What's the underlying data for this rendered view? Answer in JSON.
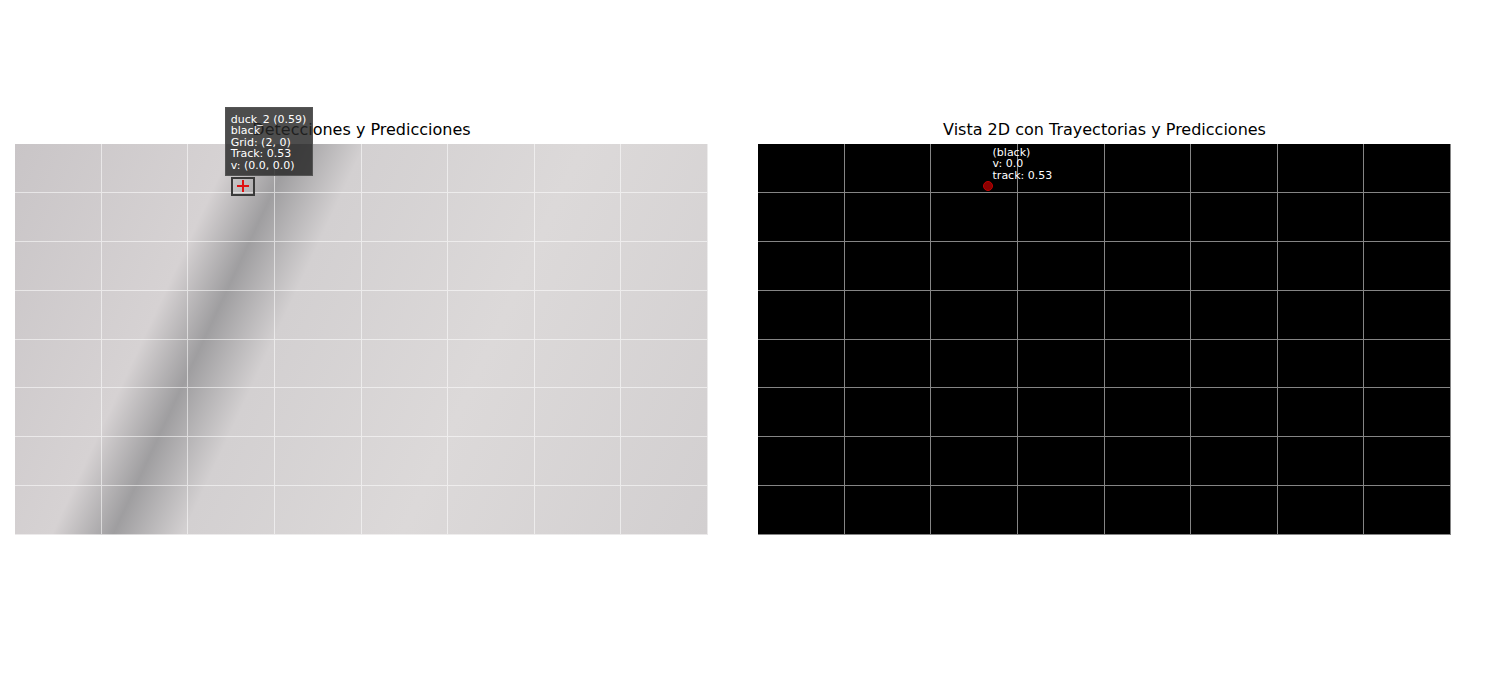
{
  "figure": {
    "grid": {
      "cols": 8,
      "rows": 8
    },
    "panels": [
      {
        "kind": "frame",
        "title": "Detecciones y Predicciones",
        "detections": [
          {
            "x": 2.63,
            "y": 0.86,
            "tooltip": [
              "duck_2 (0.59)",
              "black",
              "Grid: (2, 0)",
              "Track: 0.53",
              "v: (0.0, 0.0)"
            ]
          }
        ]
      },
      {
        "kind": "map",
        "title": "Vista 2D con Trayectorias y Predicciones",
        "detections": [
          {
            "x": 2.65,
            "y": 0.86,
            "tooltip": [
              "(black)",
              "v: 0.0",
              "track: 0.53"
            ]
          }
        ]
      }
    ]
  }
}
